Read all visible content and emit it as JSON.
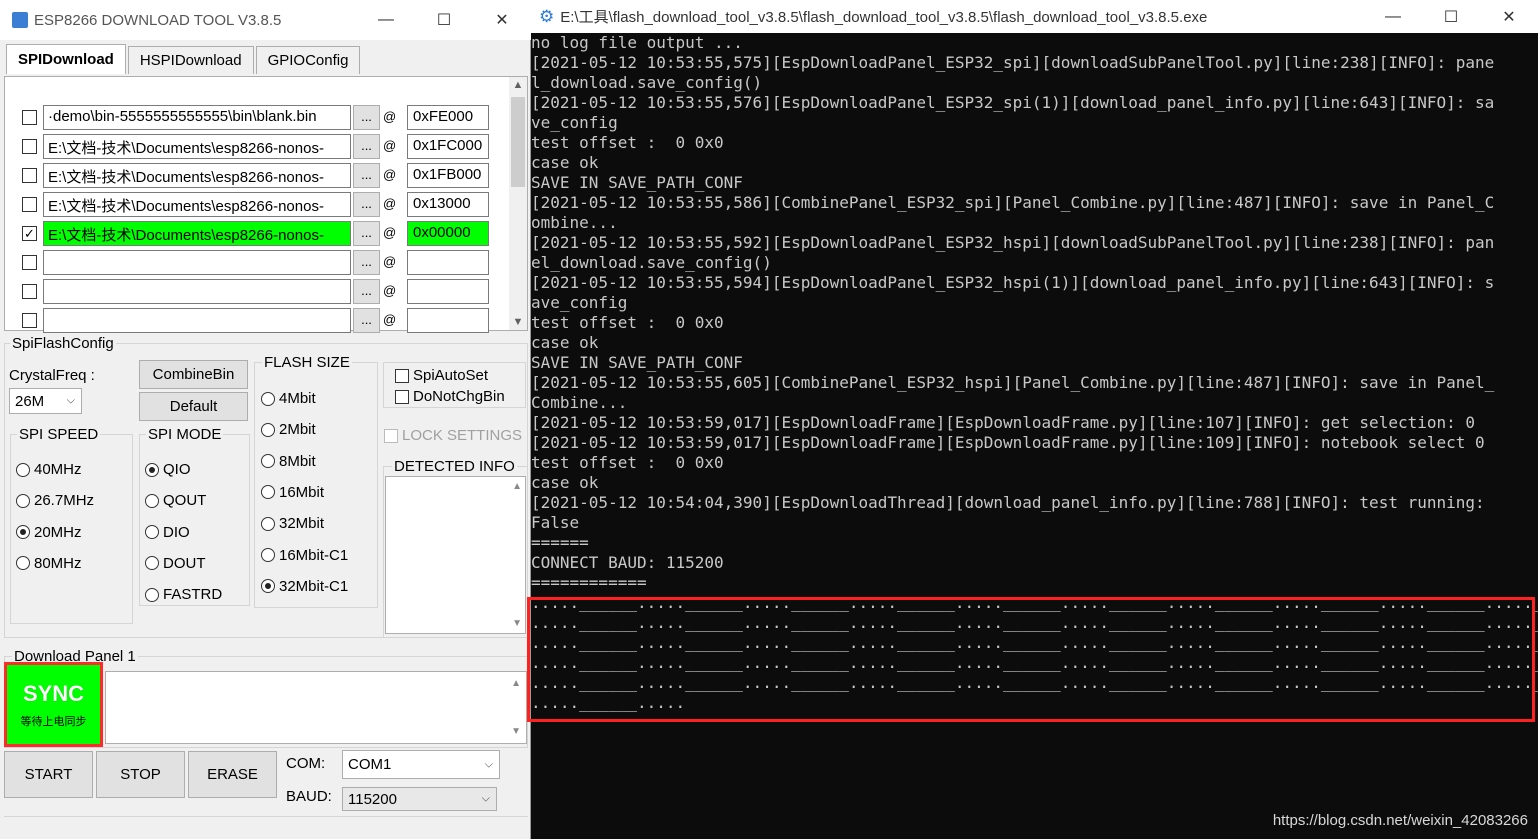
{
  "left_window": {
    "title": "ESP8266 DOWNLOAD TOOL V3.8.5",
    "tabs": [
      "SPIDownload",
      "HSPIDownload",
      "GPIOConfig"
    ],
    "files": [
      {
        "checked": false,
        "path": "·demo\\bin-5555555555555\\bin\\blank.bin",
        "addr": "0xFE000",
        "highlight": false
      },
      {
        "checked": false,
        "path": "E:\\文档-技术\\Documents\\esp8266-nonos-",
        "addr": "0x1FC000",
        "highlight": false
      },
      {
        "checked": false,
        "path": "E:\\文档-技术\\Documents\\esp8266-nonos-",
        "addr": "0x1FB000",
        "highlight": false
      },
      {
        "checked": false,
        "path": "E:\\文档-技术\\Documents\\esp8266-nonos-",
        "addr": "0x13000",
        "highlight": false
      },
      {
        "checked": true,
        "path": "E:\\文档-技术\\Documents\\esp8266-nonos-",
        "addr": "0x00000",
        "highlight": true
      },
      {
        "checked": false,
        "path": "",
        "addr": "",
        "highlight": false
      },
      {
        "checked": false,
        "path": "",
        "addr": "",
        "highlight": false
      },
      {
        "checked": false,
        "path": "",
        "addr": "",
        "highlight": false
      }
    ],
    "browse_label": "...",
    "at_label": "@",
    "spi_flash_config": "SpiFlashConfig",
    "crystal_label": "CrystalFreq :",
    "crystal_value": "26M",
    "combine_label": "CombineBin",
    "default_label": "Default",
    "flash_size_label": "FLASH SIZE",
    "flash_sizes": [
      {
        "label": "4Mbit",
        "on": false
      },
      {
        "label": "2Mbit",
        "on": false
      },
      {
        "label": "8Mbit",
        "on": false
      },
      {
        "label": "16Mbit",
        "on": false
      },
      {
        "label": "32Mbit",
        "on": false
      },
      {
        "label": "16Mbit-C1",
        "on": false
      },
      {
        "label": "32Mbit-C1",
        "on": true
      }
    ],
    "spi_speed_label": "SPI SPEED",
    "spi_speeds": [
      {
        "label": "40MHz",
        "on": false
      },
      {
        "label": "26.7MHz",
        "on": false
      },
      {
        "label": "20MHz",
        "on": true
      },
      {
        "label": "80MHz",
        "on": false
      }
    ],
    "spi_mode_label": "SPI MODE",
    "spi_modes": [
      {
        "label": "QIO",
        "on": true
      },
      {
        "label": "QOUT",
        "on": false
      },
      {
        "label": "DIO",
        "on": false
      },
      {
        "label": "DOUT",
        "on": false
      },
      {
        "label": "FASTRD",
        "on": false
      }
    ],
    "spi_auto_set": "SpiAutoSet",
    "do_not_chg_bin": "DoNotChgBin",
    "lock_settings": "LOCK SETTINGS",
    "detected_info": "DETECTED INFO",
    "download_panel": "Download Panel 1",
    "sync_big": "SYNC",
    "sync_small": "等待上电同步",
    "start": "START",
    "stop": "STOP",
    "erase": "ERASE",
    "com_label": "COM:",
    "com_value": "COM1",
    "baud_label": "BAUD:",
    "baud_value": "115200"
  },
  "right_window": {
    "title": "E:\\工具\\flash_download_tool_v3.8.5\\flash_download_tool_v3.8.5\\flash_download_tool_v3.8.5.exe",
    "lines": [
      "no log file output ...",
      "[2021-05-12 10:53:55,575][EspDownloadPanel_ESP32_spi][downloadSubPanelTool.py][line:238][INFO]: pane",
      "l_download.save_config()",
      "[2021-05-12 10:53:55,576][EspDownloadPanel_ESP32_spi(1)][download_panel_info.py][line:643][INFO]: sa",
      "ve_config",
      "test offset :  0 0x0",
      "case ok",
      "SAVE IN SAVE_PATH_CONF",
      "[2021-05-12 10:53:55,586][CombinePanel_ESP32_spi][Panel_Combine.py][line:487][INFO]: save in Panel_C",
      "ombine...",
      "[2021-05-12 10:53:55,592][EspDownloadPanel_ESP32_hspi][downloadSubPanelTool.py][line:238][INFO]: pan",
      "el_download.save_config()",
      "[2021-05-12 10:53:55,594][EspDownloadPanel_ESP32_hspi(1)][download_panel_info.py][line:643][INFO]: s",
      "ave_config",
      "test offset :  0 0x0",
      "case ok",
      "SAVE IN SAVE_PATH_CONF",
      "[2021-05-12 10:53:55,605][CombinePanel_ESP32_hspi][Panel_Combine.py][line:487][INFO]: save in Panel_",
      "Combine...",
      "[2021-05-12 10:53:59,017][EspDownloadFrame][EspDownloadFrame.py][line:107][INFO]: get selection: 0",
      "[2021-05-12 10:53:59,017][EspDownloadFrame][EspDownloadFrame.py][line:109][INFO]: notebook select 0",
      "test offset :  0 0x0",
      "case ok",
      "[2021-05-12 10:54:04,390][EspDownloadThread][download_panel_info.py][line:788][INFO]: test running:",
      "False",
      "======",
      "CONNECT BAUD: 115200",
      "============",
      ".....______.....______.....______.....______.....______.....______.....______.....______.....______.....______",
      ".....______.....______.....______.....______.....______.....______.....______.....______.....______.....______",
      ".....______.....______.....______.....______.....______.....______.....______.....______.....______.....______",
      ".....______.....______.....______.....______.....______.....______.....______.....______.....______.....______",
      ".....______.....______.....______.....______.....______.....______.....______.....______.....______.....______",
      ".....______....."
    ]
  },
  "watermark": "https://blog.csdn.net/weixin_42083266"
}
